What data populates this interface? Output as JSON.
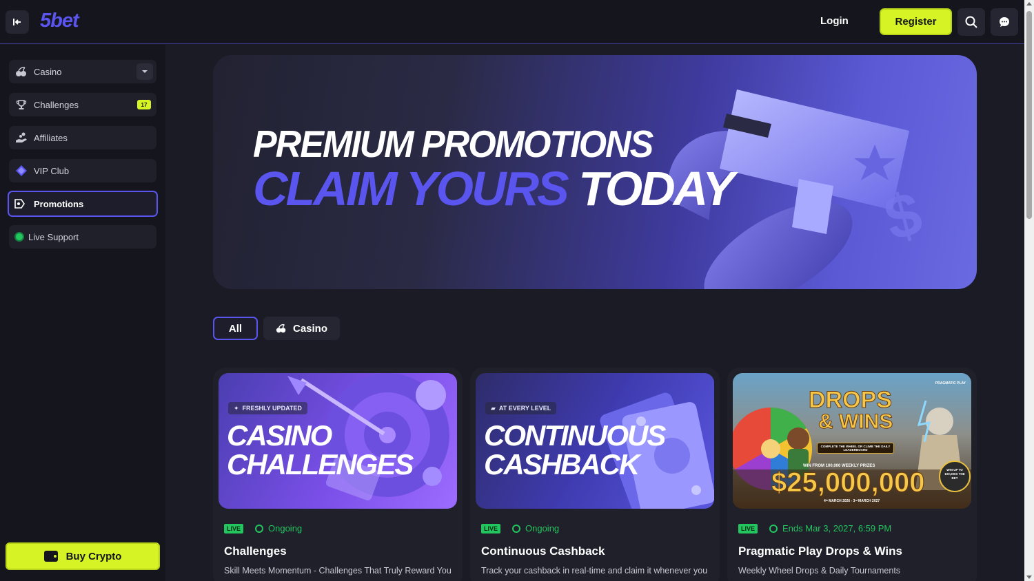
{
  "header": {
    "logo": "5bet",
    "login_label": "Login",
    "register_label": "Register",
    "icons": [
      "collapse-sidebar-icon",
      "search-icon",
      "chat-icon"
    ]
  },
  "sidebar": {
    "items": [
      {
        "label": "Casino",
        "icon": "cherries-icon",
        "has_dropdown": true
      },
      {
        "label": "Challenges",
        "icon": "trophy-icon",
        "badge": "17"
      },
      {
        "label": "Affiliates",
        "icon": "hand-coins-icon"
      },
      {
        "label": "VIP Club",
        "icon": "diamond-icon"
      },
      {
        "label": "Promotions",
        "icon": "promo-ticket-icon",
        "active": true
      },
      {
        "label": "Live Support",
        "icon": "status-dot-icon",
        "status_color": "#22c55e"
      }
    ],
    "buy_crypto_label": "Buy Crypto"
  },
  "hero": {
    "line1": "PREMIUM PROMOTIONS",
    "line2_accent": "CLAIM YOURS",
    "line2_white": "TODAY"
  },
  "filters": {
    "all_label": "All",
    "casino_label": "Casino",
    "active": "All"
  },
  "cards": [
    {
      "image_tag": "FRESHLY UPDATED",
      "image_title": "CASINO\nCHALLENGES",
      "live": "LIVE",
      "status": "Ongoing",
      "title": "Challenges",
      "description": "Skill Meets Momentum - Challenges That Truly Reward You"
    },
    {
      "image_tag": "AT EVERY LEVEL",
      "image_title": "CONTINUOUS\nCASHBACK",
      "live": "LIVE",
      "status": "Ongoing",
      "title": "Continuous Cashback",
      "description": "Track your cashback in real-time and claim it whenever you"
    },
    {
      "image_brand": "PRAGMATIC PLAY",
      "image_title_1": "DROPS",
      "image_title_2": "& WINS",
      "image_sub": "COMPLETE THE WHEEL OR CLIMB THE DAILY LEADERBOARD",
      "image_prize_label": "WIN FROM 100,000 WEEKLY PRIZES",
      "image_amount": "$25,000,000",
      "image_dates": "4ᵗʰ MARCH 2026 - 3ʳᵈ MARCH 2027",
      "image_win_badge": "WIN UP TO 100,000X THE BET",
      "live": "LIVE",
      "status": "Ends Mar 3, 2027, 6:59 PM",
      "title": "Pragmatic Play Drops & Wins",
      "description": "Weekly Wheel Drops & Daily Tournaments"
    }
  ],
  "colors": {
    "accent": "#5b55f0",
    "cta": "#d6f326",
    "live_green": "#22c55e",
    "bg": "#1b1b26",
    "sidebar_bg": "#15151d"
  }
}
